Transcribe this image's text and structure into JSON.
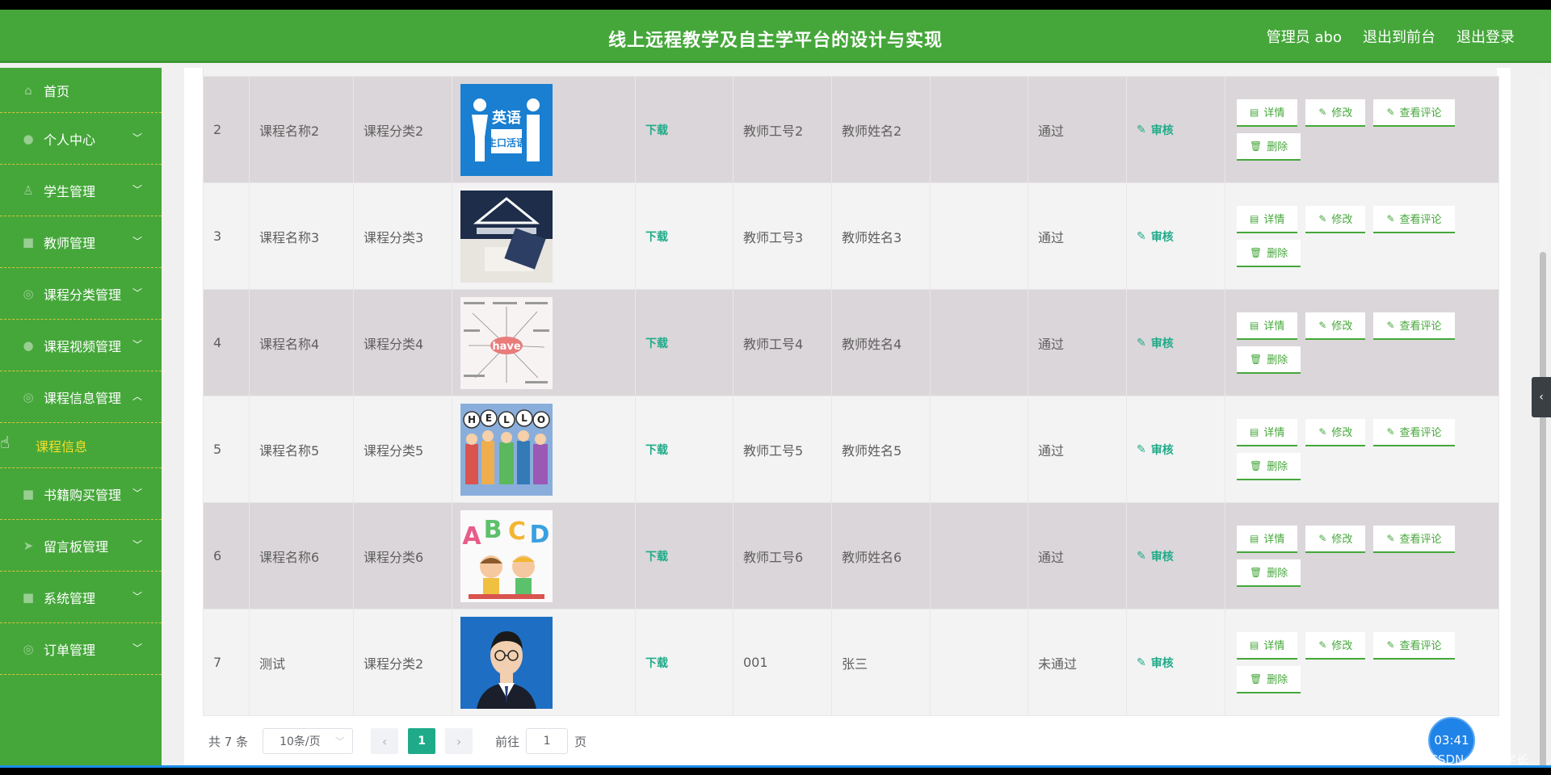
{
  "header": {
    "title": "线上远程教学及自主学平台的设计与实现",
    "admin_label": "管理员 abo",
    "to_front": "退出到前台",
    "logout": "退出登录"
  },
  "sidebar": {
    "items": [
      {
        "label": "首页",
        "icon": "home-icon"
      },
      {
        "label": "个人中心",
        "icon": "user-icon"
      },
      {
        "label": "学生管理",
        "icon": "student-icon"
      },
      {
        "label": "教师管理",
        "icon": "teacher-icon"
      },
      {
        "label": "课程分类管理",
        "icon": "category-icon"
      },
      {
        "label": "课程视频管理",
        "icon": "video-icon"
      },
      {
        "label": "课程信息管理",
        "icon": "info-icon"
      },
      {
        "label": "书籍购买管理",
        "icon": "book-icon"
      },
      {
        "label": "留言板管理",
        "icon": "message-icon"
      },
      {
        "label": "系统管理",
        "icon": "system-icon"
      },
      {
        "label": "订单管理",
        "icon": "order-icon"
      }
    ],
    "sub_item": "课程信息"
  },
  "table": {
    "download_label": "下载",
    "audit_label": "审核",
    "op_detail": "详情",
    "op_edit": "修改",
    "op_comments": "查看评论",
    "op_delete": "删除",
    "rows": [
      {
        "idx": "2",
        "name": "课程名称2",
        "category": "课程分类2",
        "teacher_no": "教师工号2",
        "teacher_name": "教师姓名2",
        "status": "通过",
        "img_text": "英语生口活语"
      },
      {
        "idx": "3",
        "name": "课程名称3",
        "category": "课程分类3",
        "teacher_no": "教师工号3",
        "teacher_name": "教师姓名3",
        "status": "通过",
        "img_text": ""
      },
      {
        "idx": "4",
        "name": "课程名称4",
        "category": "课程分类4",
        "teacher_no": "教师工号4",
        "teacher_name": "教师姓名4",
        "status": "通过",
        "img_text": "have"
      },
      {
        "idx": "5",
        "name": "课程名称5",
        "category": "课程分类5",
        "teacher_no": "教师工号5",
        "teacher_name": "教师姓名5",
        "status": "通过",
        "img_text": "HELLO"
      },
      {
        "idx": "6",
        "name": "课程名称6",
        "category": "课程分类6",
        "teacher_no": "教师工号6",
        "teacher_name": "教师姓名6",
        "status": "通过",
        "img_text": "ABCD"
      },
      {
        "idx": "7",
        "name": "测试",
        "category": "课程分类2",
        "teacher_no": "001",
        "teacher_name": "张三",
        "status": "未通过",
        "img_text": ""
      }
    ]
  },
  "pager": {
    "total": "共 7 条",
    "page_size": "10条/页",
    "current_page": "1",
    "goto_prefix": "前往",
    "goto_value": "1",
    "goto_suffix": "页"
  },
  "overlay": {
    "timer": "03:41",
    "watermark": "CSDN @卓杰学长"
  }
}
